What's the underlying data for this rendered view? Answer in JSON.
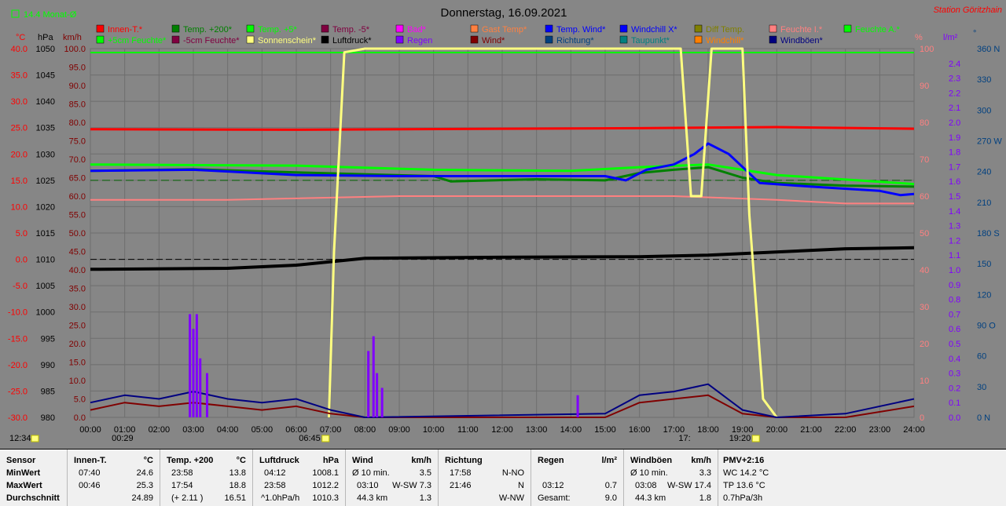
{
  "chart_data": {
    "type": "line",
    "title": "Donnerstag, 16.09.2021",
    "station": "Station Göritzhain",
    "month_avg_label": "14.4 Monat-Ø",
    "axis_units": {
      "temp": "°C",
      "pressure": "hPa",
      "wind": "km/h",
      "humidity": "%",
      "rain": "l/m²",
      "direction": "°"
    },
    "temp_ticks": [
      "40.0",
      "35.0",
      "30.0",
      "25.0",
      "20.0",
      "15.0",
      "10.0",
      "5.0",
      "0.0",
      "-5.0",
      "-10.0",
      "-15.0",
      "-20.0",
      "-25.0",
      "-30.0"
    ],
    "pressure_ticks": [
      "1050",
      "1045",
      "1040",
      "1035",
      "1030",
      "1025",
      "1020",
      "1015",
      "1010",
      "1005",
      "1000",
      "995",
      "990",
      "985",
      "980"
    ],
    "wind_ticks": [
      "100.0",
      "95.0",
      "90.0",
      "85.0",
      "80.0",
      "75.0",
      "70.0",
      "65.0",
      "60.0",
      "55.0",
      "50.0",
      "45.0",
      "40.0",
      "35.0",
      "30.0",
      "25.0",
      "20.0",
      "15.0",
      "10.0",
      "5.0",
      "0.0"
    ],
    "humidity_ticks": [
      "100",
      "90",
      "80",
      "70",
      "60",
      "50",
      "40",
      "30",
      "20",
      "10",
      "0"
    ],
    "rain_ticks": [
      "2.4",
      "2.3",
      "2.2",
      "2.1",
      "2.0",
      "1.9",
      "1.8",
      "1.7",
      "1.6",
      "1.5",
      "1.4",
      "1.3",
      "1.2",
      "1.1",
      "1.0",
      "0.9",
      "0.8",
      "0.7",
      "0.6",
      "0.5",
      "0.4",
      "0.3",
      "0.2",
      "0.1",
      "0.0"
    ],
    "direction_ticks": [
      "360 N",
      "330",
      "300",
      "270 W",
      "240",
      "210",
      "180 S",
      "150",
      "120",
      "90 O",
      "60",
      "30",
      "0 N"
    ],
    "x_ticks": [
      "00:00",
      "01:00",
      "02:00",
      "03:00",
      "04:00",
      "05:00",
      "06:00",
      "07:00",
      "08:00",
      "09:00",
      "10:00",
      "11:00",
      "12:00",
      "13:00",
      "14:00",
      "15:00",
      "16:00",
      "17:00",
      "18:00",
      "19:00",
      "20:00",
      "21:00",
      "22:00",
      "23:00",
      "24:00"
    ],
    "markers": {
      "now": "12:34",
      "moonrise": "00:29",
      "sunrise": "06:45",
      "moonset": "17:",
      "sunset": "19:20"
    },
    "legend": [
      {
        "label": "Innen-T.*",
        "color": "#ff0000"
      },
      {
        "label": "Temp. +200*",
        "color": "#008000"
      },
      {
        "label": "Temp. +5*",
        "color": "#00ff00"
      },
      {
        "label": "Temp. -5*",
        "color": "#800040"
      },
      {
        "label": "Bad*",
        "color": "#ff00ff"
      },
      {
        "label": "Gast Temp*",
        "color": "#ff8040"
      },
      {
        "label": "Temp. Wind*",
        "color": "#0000ff"
      },
      {
        "label": "Windchill X*",
        "color": "#0000ff"
      },
      {
        "label": "Diff Temp.",
        "color": "#808000"
      },
      {
        "label": "Feuchte I.*",
        "color": "#ff8080"
      },
      {
        "label": "Feuchte A.*",
        "color": "#00ff00"
      },
      {
        "label": "+5cm Feuchte*",
        "color": "#00ff00"
      },
      {
        "label": "-5cm Feuchte*",
        "color": "#800040"
      },
      {
        "label": "Sonnenschein*",
        "color": "#ffff80"
      },
      {
        "label": "Luftdruck*",
        "color": "#000000"
      },
      {
        "label": "Regen",
        "color": "#8000ff"
      },
      {
        "label": "Wind*",
        "color": "#800000"
      },
      {
        "label": "Richtung*",
        "color": "#004080"
      },
      {
        "label": "Taupunkt*",
        "color": "#008080"
      },
      {
        "label": "Windchill*",
        "color": "#ff8000"
      },
      {
        "label": "Windböen*",
        "color": "#000080"
      }
    ],
    "series": [
      {
        "name": "Innen-T.*",
        "color": "#ff0000",
        "axis": "temp",
        "x": [
          0,
          6,
          12,
          16,
          20,
          24
        ],
        "y": [
          24.7,
          24.6,
          24.8,
          24.9,
          25.1,
          24.8
        ]
      },
      {
        "name": "Temp. +200*",
        "color": "#008000",
        "axis": "temp",
        "x": [
          0,
          3,
          6,
          10,
          10.5,
          13,
          15,
          16,
          17,
          18,
          19,
          20,
          22,
          24
        ],
        "y": [
          16.8,
          17.1,
          16.5,
          15.8,
          14.8,
          15.2,
          15.0,
          16.4,
          17.0,
          17.5,
          15.5,
          14.5,
          14.0,
          13.8
        ]
      },
      {
        "name": "Temp. +5*",
        "color": "#00ff00",
        "axis": "temp",
        "x": [
          0,
          6,
          10,
          14,
          16,
          18,
          20,
          24
        ],
        "y": [
          18.0,
          17.8,
          17.0,
          16.8,
          17.5,
          18.0,
          16.0,
          14.3
        ]
      },
      {
        "name": "Temp. Wind*",
        "color": "#0000ff",
        "axis": "temp",
        "x": [
          0,
          3,
          6,
          9,
          12,
          14,
          15,
          15.6,
          16.2,
          17,
          17.6,
          18,
          18.6,
          19.5,
          21,
          23,
          23.6,
          24
        ],
        "y": [
          16.8,
          17.0,
          16.0,
          15.8,
          15.8,
          15.8,
          15.8,
          15.0,
          17.0,
          18.0,
          20.0,
          22.0,
          20.0,
          14.5,
          13.8,
          13.0,
          12.2,
          12.4
        ]
      },
      {
        "name": "Feuchte I.*",
        "color": "#ff8080",
        "axis": "humidity",
        "x": [
          0,
          4,
          9,
          12,
          17,
          20,
          22,
          24
        ],
        "y": [
          59,
          59,
          60,
          60,
          60,
          59,
          58,
          58
        ]
      },
      {
        "name": "Luftdruck*",
        "color": "#000000",
        "axis": "pressure",
        "x": [
          0,
          4,
          6,
          8,
          12,
          16,
          18,
          22,
          24
        ],
        "y": [
          1008.1,
          1008.3,
          1008.9,
          1010.2,
          1010.4,
          1010.5,
          1010.8,
          1012.0,
          1012.2
        ]
      },
      {
        "name": "Sonnenschein*",
        "color": "#ffff80",
        "axis": "humidity",
        "x": [
          6.95,
          7.1,
          7.4,
          8,
          17.2,
          17.5,
          17.8,
          18.1,
          18.5,
          19.0,
          19.2,
          19.6,
          20
        ],
        "y": [
          0,
          45,
          99,
          100,
          100,
          60,
          60,
          100,
          100,
          100,
          55,
          5,
          0
        ]
      },
      {
        "name": "Wind*",
        "color": "#800000",
        "axis": "wind",
        "x": [
          0,
          1,
          2,
          3,
          4,
          5,
          6,
          7,
          8,
          15,
          16,
          17,
          18,
          19,
          20,
          22,
          24
        ],
        "y": [
          2,
          4,
          3,
          4,
          3,
          2,
          3,
          1,
          0,
          0,
          4,
          5,
          6,
          1,
          0,
          0,
          3
        ]
      },
      {
        "name": "Windböen*",
        "color": "#000080",
        "axis": "wind",
        "x": [
          0,
          1,
          2,
          3,
          4,
          5,
          6,
          7,
          8,
          15,
          16,
          17,
          18,
          19,
          20,
          22,
          24
        ],
        "y": [
          4,
          6,
          5,
          7,
          5,
          4,
          5,
          2,
          0,
          1,
          6,
          7,
          9,
          2,
          0,
          1,
          5
        ]
      },
      {
        "name": "Regen",
        "color": "#8000ff",
        "axis": "rain",
        "x": [
          2.9,
          3.0,
          3.1,
          3.2,
          3.4,
          8.1,
          8.25,
          8.35,
          8.5,
          14.2
        ],
        "y": [
          0.7,
          0.6,
          0.7,
          0.4,
          0.3,
          0.45,
          0.55,
          0.3,
          0.2,
          0.15
        ]
      }
    ]
  },
  "stats": {
    "headers": [
      {
        "name": "Sensor",
        "unit": ""
      },
      {
        "name": "Innen-T.",
        "unit": "°C"
      },
      {
        "name": "Temp. +200",
        "unit": "°C"
      },
      {
        "name": "Luftdruck",
        "unit": "hPa"
      },
      {
        "name": "Wind",
        "unit": "km/h"
      },
      {
        "name": "Richtung",
        "unit": ""
      },
      {
        "name": "Regen",
        "unit": "l/m²"
      },
      {
        "name": "Windböen",
        "unit": "km/h"
      },
      {
        "name": "PMV+2:16",
        "unit": ""
      }
    ],
    "rows": [
      {
        "label": "MinWert",
        "innen_time": "07:40",
        "innen": "24.6",
        "temp_time": "23:58",
        "temp": "13.8",
        "druck_time": "04:12",
        "druck": "1008.1",
        "wind_time": "Ø 10 min.",
        "wind": "3.5",
        "richt_time": "17:58",
        "richt": "N-NO",
        "regen_time": "",
        "regen": "",
        "boen_time": "Ø 10 min.",
        "boen": "3.3",
        "pmv": "WC 14.2 °C"
      },
      {
        "label": "MaxWert",
        "innen_time": "00:46",
        "innen": "25.3",
        "temp_time": "17:54",
        "temp": "18.8",
        "druck_time": "23:58",
        "druck": "1012.2",
        "wind_time": "03:10",
        "wind": "W-SW 7.3",
        "richt_time": "21:46",
        "richt": "N",
        "regen_time": "03:12",
        "regen": "0.7",
        "boen_time": "03:08",
        "boen": "W-SW 17.4",
        "pmv": "TP 13.6 °C"
      },
      {
        "label": "Durchschnitt",
        "innen_time": "",
        "innen": "24.89",
        "temp_time": "(+ 2.11 )",
        "temp": "16.51",
        "druck_time": "^1.0hPa/h",
        "druck": "1010.3",
        "wind_time": "44.3 km",
        "wind": "1.3",
        "richt_time": "",
        "richt": "W-NW",
        "regen_time": "Gesamt:",
        "regen": "9.0",
        "boen_time": "44.3 km",
        "boen": "1.8",
        "pmv": "0.7hPa/3h"
      }
    ]
  }
}
